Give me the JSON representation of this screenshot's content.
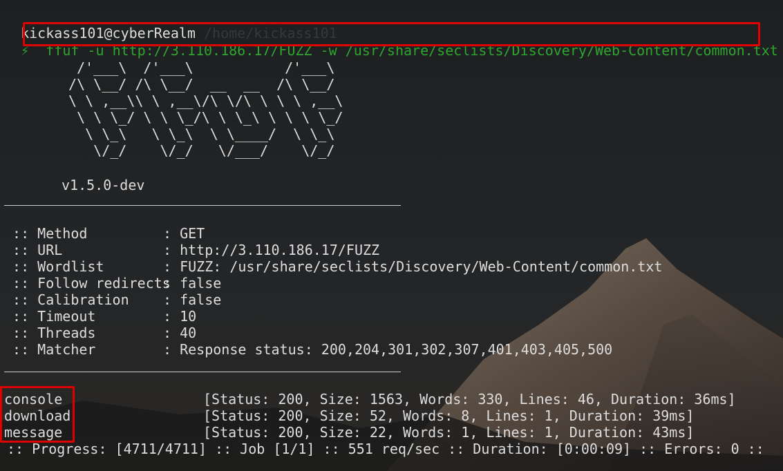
{
  "prompt": {
    "user_host": "kickass101@cyberRealm",
    "path": "/home/kickass101",
    "symbol": "⚡",
    "command": "ffuf -u http://3.110.186.17/FUZZ -w /usr/share/seclists/Discovery/Web-Content/common.txt"
  },
  "banner": {
    "ascii": "  /'___\\  /'___\\           /'___\\\n /\\ \\__/ /\\ \\__/  __  __  /\\ \\__/\n \\ \\ ,__\\\\ \\ ,__\\/\\ \\/\\ \\ \\ \\ ,__\\\n  \\ \\ \\_/ \\ \\ \\_/\\ \\ \\_\\ \\ \\ \\ \\_/\n   \\ \\_\\   \\ \\_\\  \\ \\____/  \\ \\_\\\n    \\/_/    \\/_/   \\/___/    \\/_/",
    "version": "v1.5.0-dev"
  },
  "config": [
    {
      "key": " :: Method           ",
      "value": ": GET"
    },
    {
      "key": " :: URL              ",
      "value": ": http://3.110.186.17/FUZZ"
    },
    {
      "key": " :: Wordlist         ",
      "value": ": FUZZ: /usr/share/seclists/Discovery/Web-Content/common.txt"
    },
    {
      "key": " :: Follow redirects ",
      "value": ": false"
    },
    {
      "key": " :: Calibration      ",
      "value": ": false"
    },
    {
      "key": " :: Timeout          ",
      "value": ": 10"
    },
    {
      "key": " :: Threads          ",
      "value": ": 40"
    },
    {
      "key": " :: Matcher          ",
      "value": ": Response status: 200,204,301,302,307,401,403,405,500"
    }
  ],
  "results": [
    {
      "name": "console",
      "detail": "[Status: 200, Size: 1563, Words: 330, Lines: 46, Duration: 36ms]"
    },
    {
      "name": "download",
      "detail": "[Status: 200, Size: 52, Words: 8, Lines: 1, Duration: 39ms]"
    },
    {
      "name": "message",
      "detail": "[Status: 200, Size: 22, Words: 1, Lines: 1, Duration: 43ms]"
    }
  ],
  "progress": ":: Progress: [4711/4711] :: Job [1/1] :: 551 req/sec :: Duration: [0:00:09] :: Errors: 0 ::",
  "colors": {
    "background": "#202224",
    "text": "#dedede",
    "prompt_green": "#2fa52f",
    "highlight_red": "#e00000"
  }
}
